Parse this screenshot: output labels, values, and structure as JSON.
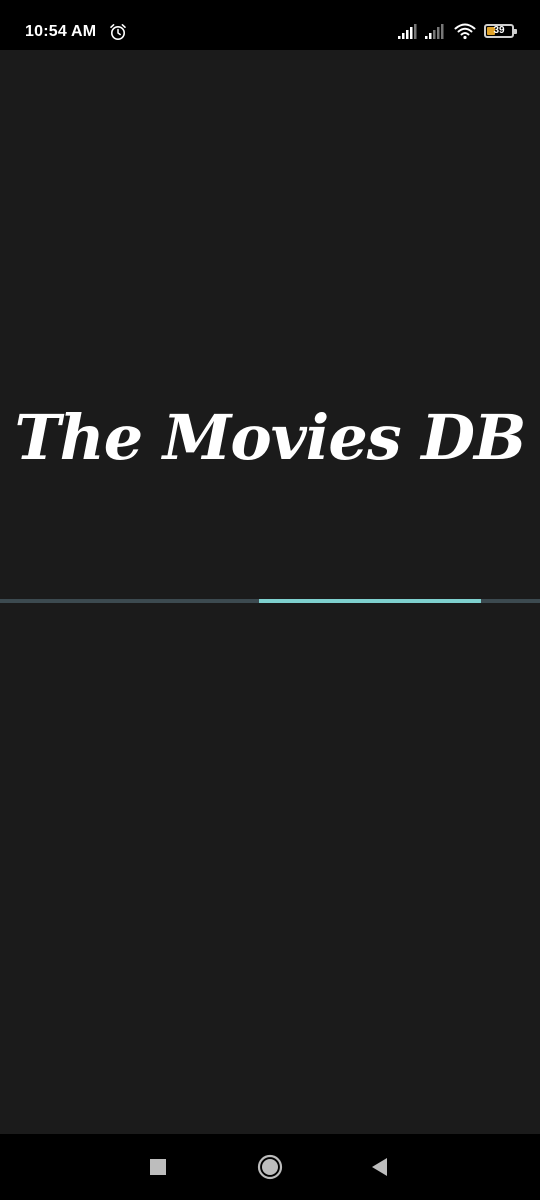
{
  "status_bar": {
    "time": "10:54 AM",
    "battery_level": "39",
    "battery_fraction": 0.39,
    "icons": [
      "alarm-icon",
      "signal-icon",
      "signal-icon",
      "wifi-icon",
      "battery-icon"
    ]
  },
  "splash": {
    "title": "The Movies DB",
    "loading_progress_start": 0.48,
    "loading_progress_end": 0.89
  },
  "nav_bar": {
    "icons": [
      "recents-square-icon",
      "home-circle-icon",
      "back-triangle-icon"
    ]
  },
  "colors": {
    "background": "#1b1b1b",
    "status_bar": "#000000",
    "progress_track": "#3c4a50",
    "progress_indicator": "#7fd1cf",
    "title": "#ffffff"
  }
}
